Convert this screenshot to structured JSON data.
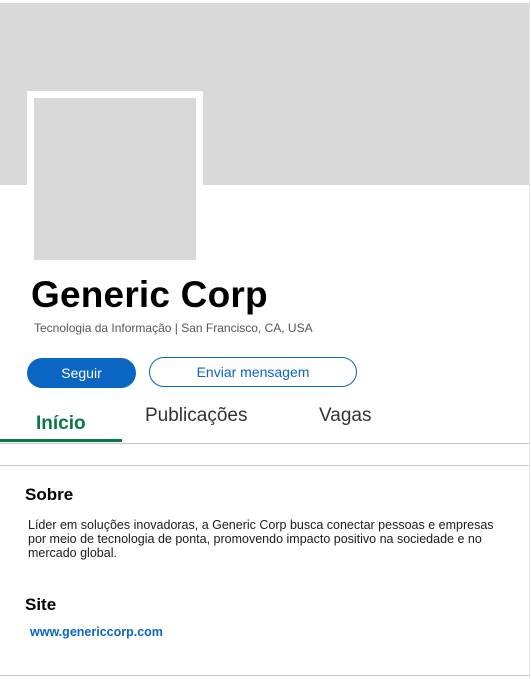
{
  "company": {
    "name": "Generic Corp",
    "tagline": "Tecnologia da Informação | San Francisco, CA, USA"
  },
  "actions": {
    "follow_label": "Seguir",
    "message_label": "Enviar mensagem"
  },
  "tabs": [
    {
      "label": "Início",
      "active": true
    },
    {
      "label": "Publicações",
      "active": false
    },
    {
      "label": "Vagas",
      "active": false
    }
  ],
  "about": {
    "title": "Sobre",
    "text": "Líder em soluções inovadoras, a Generic Corp busca conectar pessoas e empresas por meio de tecnologia de ponta, promovendo impacto positivo na sociedade e no mercado global."
  },
  "site": {
    "title": "Site",
    "url": "www.genericcorp.com"
  },
  "colors": {
    "accent": "#0a66c2",
    "active_tab": "#067a46",
    "placeholder": "#d9d9d9"
  }
}
